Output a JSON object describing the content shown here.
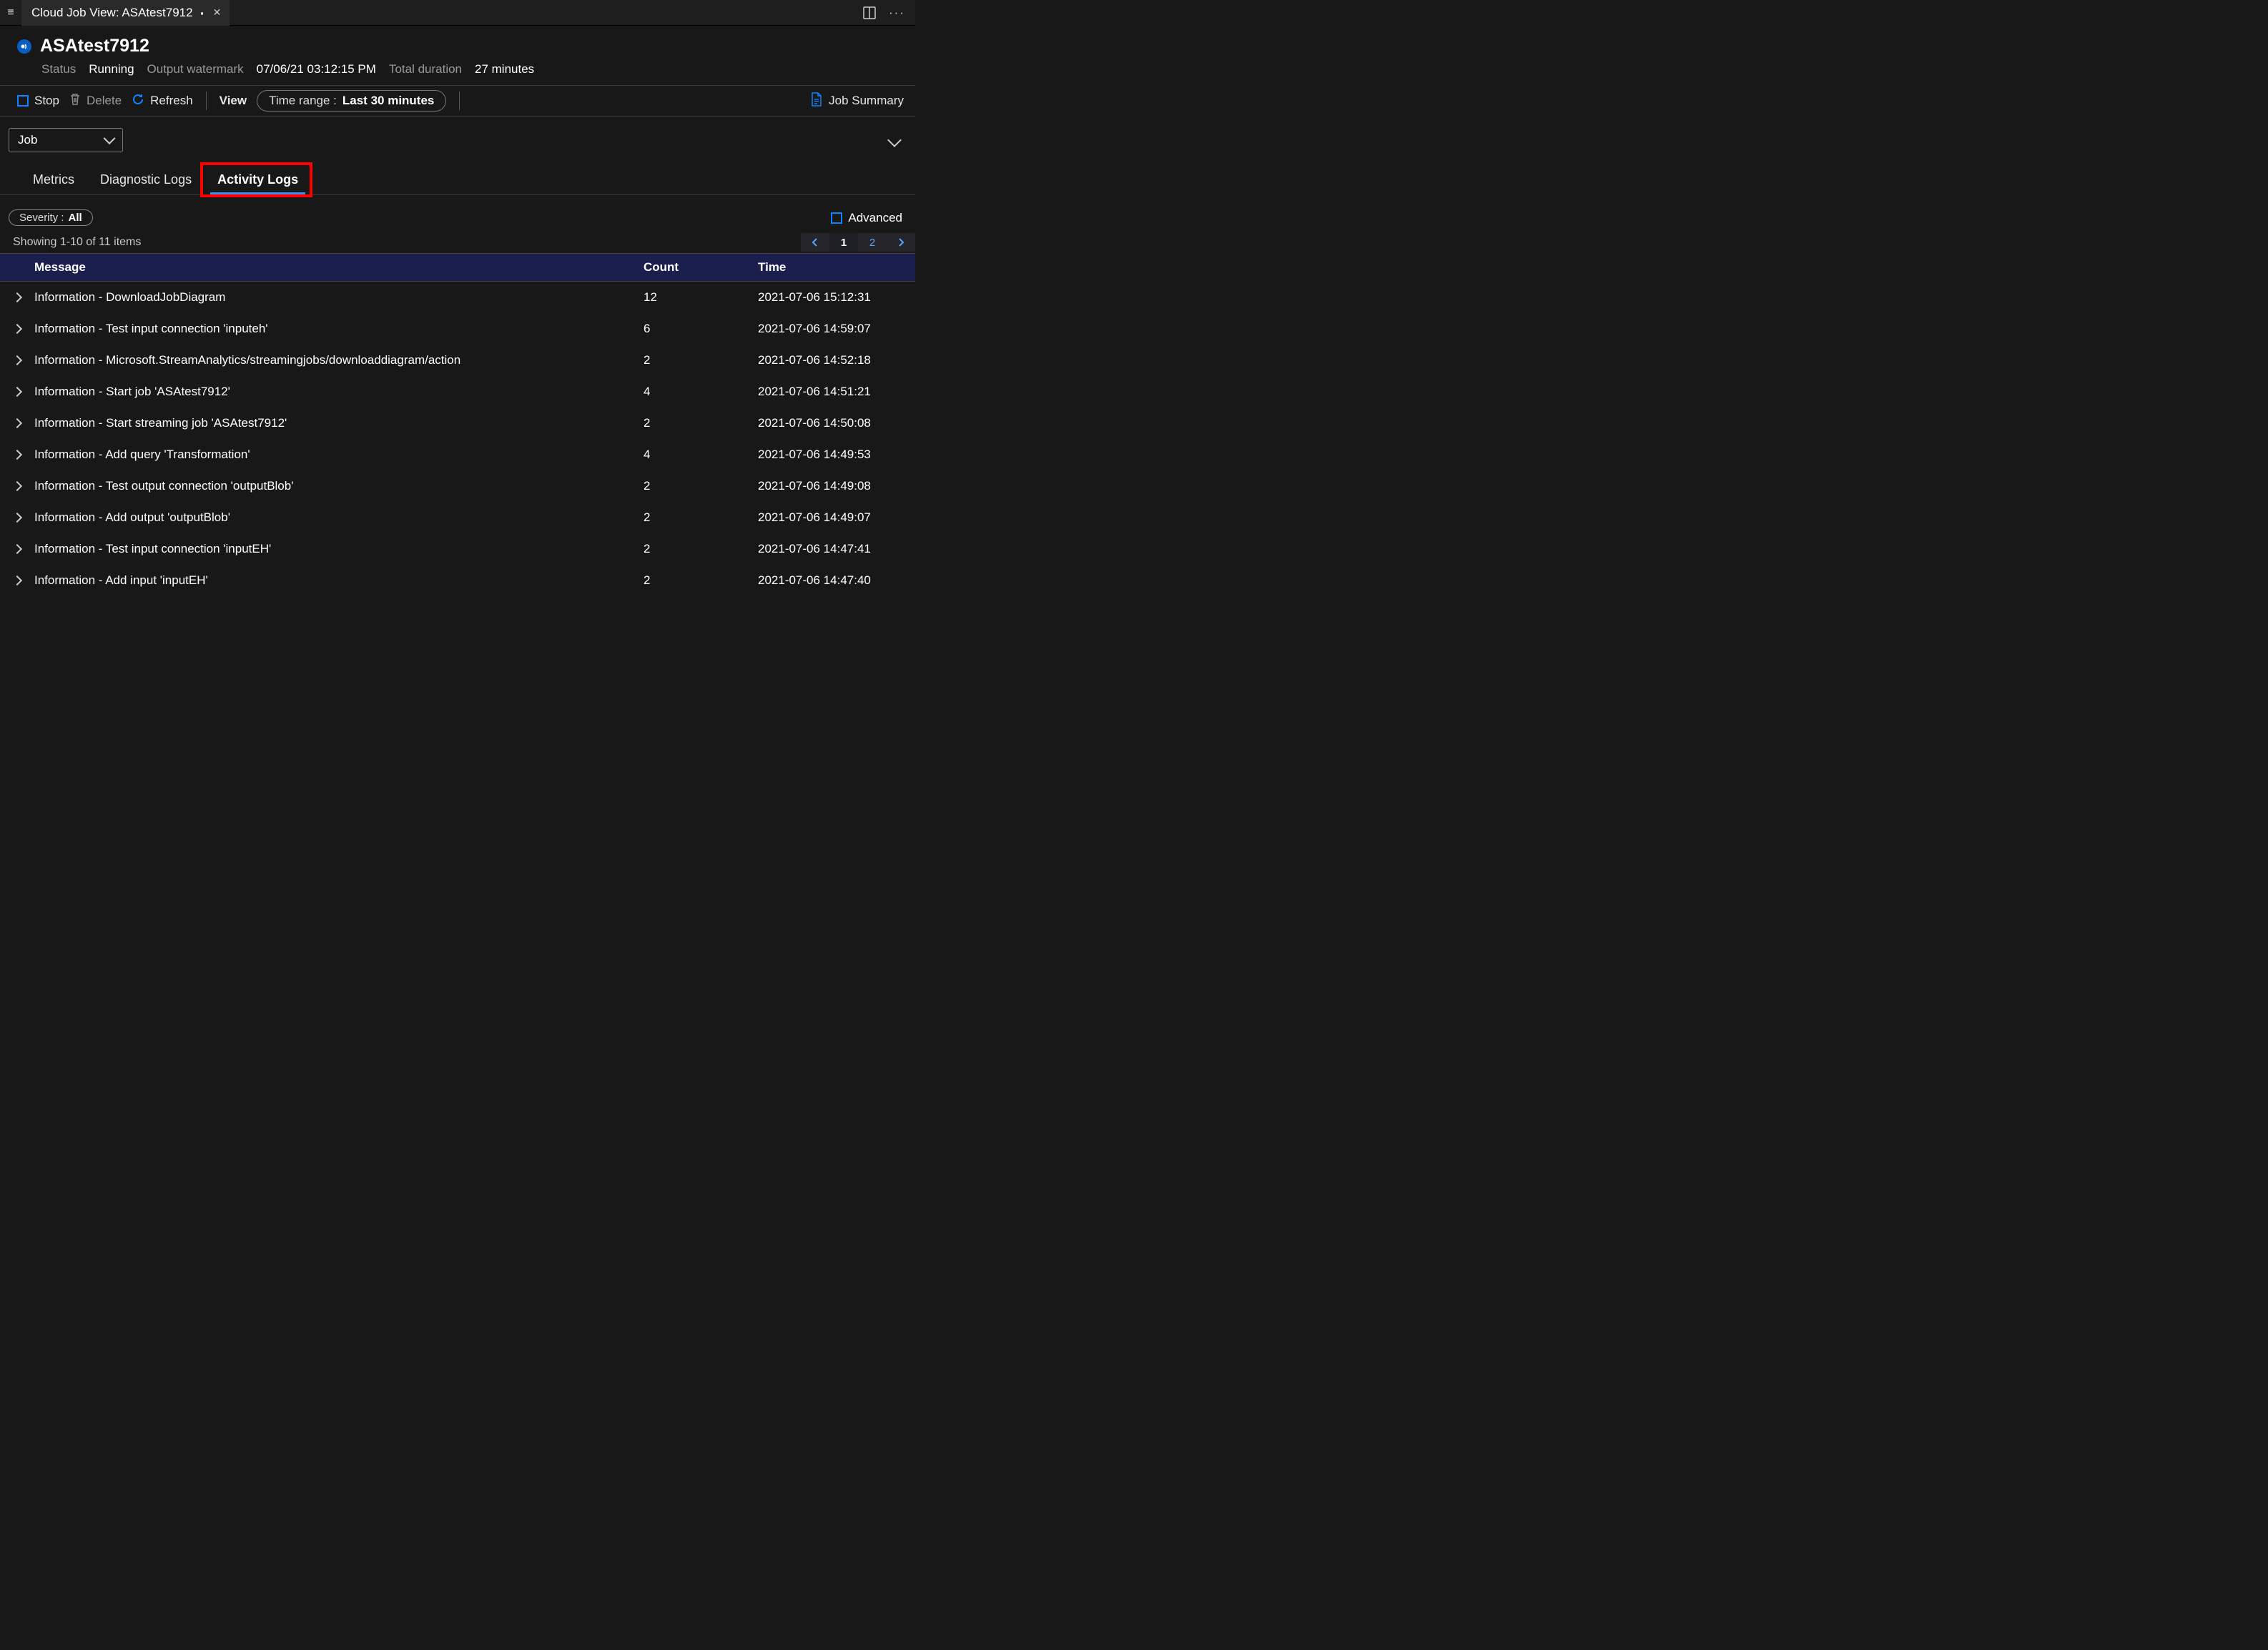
{
  "titlebar": {
    "tab_title": "Cloud Job View: ASAtest7912"
  },
  "controls": {
    "panel_tooltip": "Split editor",
    "more_tooltip": "More actions"
  },
  "header": {
    "title": "ASAtest7912",
    "status_label": "Status",
    "status_value": "Running",
    "watermark_label": "Output watermark",
    "watermark_value": "07/06/21 03:12:15 PM",
    "duration_label": "Total duration",
    "duration_value": "27 minutes"
  },
  "toolbar": {
    "stop": "Stop",
    "delete": "Delete",
    "refresh": "Refresh",
    "view": "View",
    "time_label": "Time range :",
    "time_value": "Last 30 minutes",
    "job_summary": "Job Summary"
  },
  "dropdown": {
    "value": "Job"
  },
  "tabs": {
    "metrics": "Metrics",
    "diagnostic": "Diagnostic Logs",
    "activity": "Activity Logs"
  },
  "filter": {
    "severity_label": "Severity :",
    "severity_value": "All",
    "advanced": "Advanced"
  },
  "pager": {
    "summary": "Showing 1-10 of 11 items",
    "current": "1",
    "other": "2"
  },
  "columns": {
    "message": "Message",
    "count": "Count",
    "time": "Time"
  },
  "rows": [
    {
      "msg": "Information - DownloadJobDiagram",
      "count": "12",
      "time": "2021-07-06 15:12:31"
    },
    {
      "msg": "Information - Test input connection 'inputeh'",
      "count": "6",
      "time": "2021-07-06 14:59:07"
    },
    {
      "msg": "Information - Microsoft.StreamAnalytics/streamingjobs/downloaddiagram/action",
      "count": "2",
      "time": "2021-07-06 14:52:18"
    },
    {
      "msg": "Information - Start job 'ASAtest7912'",
      "count": "4",
      "time": "2021-07-06 14:51:21"
    },
    {
      "msg": "Information - Start streaming job 'ASAtest7912'",
      "count": "2",
      "time": "2021-07-06 14:50:08"
    },
    {
      "msg": "Information - Add query 'Transformation'",
      "count": "4",
      "time": "2021-07-06 14:49:53"
    },
    {
      "msg": "Information - Test output connection 'outputBlob'",
      "count": "2",
      "time": "2021-07-06 14:49:08"
    },
    {
      "msg": "Information - Add output 'outputBlob'",
      "count": "2",
      "time": "2021-07-06 14:49:07"
    },
    {
      "msg": "Information - Test input connection 'inputEH'",
      "count": "2",
      "time": "2021-07-06 14:47:41"
    },
    {
      "msg": "Information - Add input 'inputEH'",
      "count": "2",
      "time": "2021-07-06 14:47:40"
    }
  ]
}
